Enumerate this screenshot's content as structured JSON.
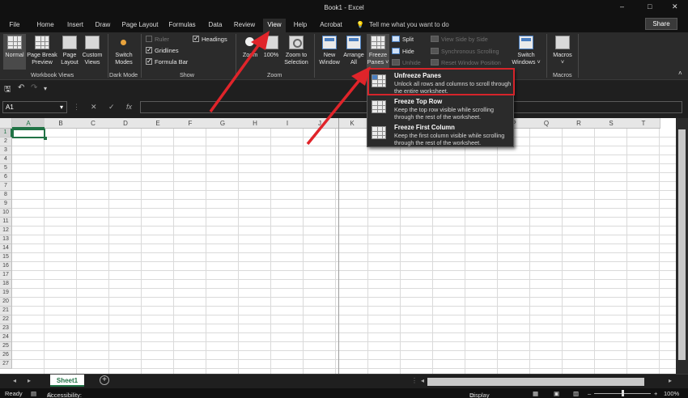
{
  "window": {
    "title": "Book1  -  Excel",
    "controls": [
      "–",
      "□",
      "✕"
    ]
  },
  "tabs": [
    {
      "label": "File"
    },
    {
      "label": "Home"
    },
    {
      "label": "Insert"
    },
    {
      "label": "Draw"
    },
    {
      "label": "Page Layout"
    },
    {
      "label": "Formulas"
    },
    {
      "label": "Data"
    },
    {
      "label": "Review"
    },
    {
      "label": "View"
    },
    {
      "label": "Help"
    },
    {
      "label": "Acrobat"
    }
  ],
  "tell_me": "Tell me what you want to do",
  "share": "Share",
  "ribbon": {
    "workbook_views": {
      "label": "Workbook Views",
      "normal": "Normal",
      "page_break_1": "Page Break",
      "page_break_2": "Preview",
      "page_layout_1": "Page",
      "page_layout_2": "Layout",
      "custom_1": "Custom",
      "custom_2": "Views"
    },
    "dark_mode": {
      "label": "Dark Mode",
      "switch_1": "Switch",
      "switch_2": "Modes"
    },
    "show": {
      "label": "Show",
      "ruler": "Ruler",
      "gridlines": "Gridlines",
      "formula_bar": "Formula Bar",
      "headings": "Headings"
    },
    "zoom": {
      "label": "Zoom",
      "zoom": "Zoom",
      "hundred": "100%",
      "sel_1": "Zoom to",
      "sel_2": "Selection"
    },
    "window": {
      "new_1": "New",
      "new_2": "Window",
      "arrange_1": "Arrange",
      "arrange_2": "All",
      "freeze_1": "Freeze",
      "freeze_2": "Panes ˅",
      "split": "Split",
      "hide": "Hide",
      "unhide": "Unhide",
      "side": "View Side by Side",
      "sync": "Synchronous Scrolling",
      "reset": "Reset Window Position",
      "switch_1": "Switch",
      "switch_2": "Windows ˅"
    },
    "macros": {
      "label": "Macros",
      "macros": "Macros",
      "caret": "˅"
    }
  },
  "formula_bar": {
    "name_box": "A1",
    "caret": "▾",
    "cancel": "✕",
    "enter": "✓",
    "fx": "fx"
  },
  "grid": {
    "columns": [
      "A",
      "B",
      "C",
      "D",
      "E",
      "F",
      "G",
      "H",
      "I",
      "J",
      "K",
      "L",
      "M",
      "N",
      "O",
      "P",
      "Q",
      "R",
      "S",
      "T"
    ],
    "rows": [
      "1",
      "2",
      "3",
      "4",
      "5",
      "6",
      "7",
      "8",
      "9",
      "10",
      "11",
      "12",
      "13",
      "14",
      "15",
      "16",
      "17",
      "18",
      "19",
      "20",
      "21",
      "22",
      "23",
      "24",
      "25",
      "26",
      "27"
    ]
  },
  "freeze_menu": [
    {
      "title": "Unfreeze Panes",
      "desc": "Unlock all rows and columns to scroll through the entire worksheet."
    },
    {
      "title": "Freeze Top Row",
      "desc": "Keep the top row visible while scrolling through the rest of the worksheet."
    },
    {
      "title": "Freeze First Column",
      "desc": "Keep the first column visible while scrolling through the rest of the worksheet."
    }
  ],
  "sheets": {
    "active": "Sheet1",
    "add": "+"
  },
  "status": {
    "ready": "Ready",
    "accessibility": "Accessibility: Good to go",
    "display_settings": "Display Settings",
    "zoom_minus": "–",
    "zoom_plus": "+",
    "zoom": "100%"
  },
  "colors": {
    "accent": "#217346",
    "highlight": "#d6242a",
    "arrow": "#e0242a"
  }
}
